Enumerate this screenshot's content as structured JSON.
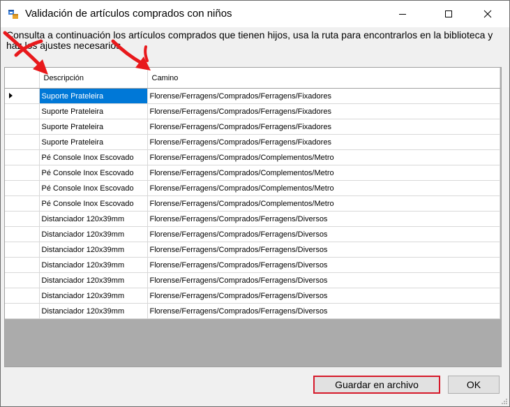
{
  "window": {
    "title": "Validación de artículos comprados con niños",
    "app_icon": "window-app-icon",
    "controls": {
      "minimize": "minimize-icon",
      "maximize": "maximize-icon",
      "close": "close-icon"
    }
  },
  "description": "Consulta a continuación los artículos comprados que tienen hijos, usa la ruta para encontrarlos en la biblioteca y haz los ajustes necesarios.",
  "grid": {
    "columns": [
      "Descripción",
      "Camino"
    ],
    "rows": [
      {
        "descripcion": "Suporte Prateleira",
        "camino": "Florense/Ferragens/Comprados/Ferragens/Fixadores"
      },
      {
        "descripcion": "Suporte Prateleira",
        "camino": "Florense/Ferragens/Comprados/Ferragens/Fixadores"
      },
      {
        "descripcion": "Suporte Prateleira",
        "camino": "Florense/Ferragens/Comprados/Ferragens/Fixadores"
      },
      {
        "descripcion": "Suporte Prateleira",
        "camino": "Florense/Ferragens/Comprados/Ferragens/Fixadores"
      },
      {
        "descripcion": "Pé Console Inox Escovado",
        "camino": "Florense/Ferragens/Comprados/Complementos/Metro"
      },
      {
        "descripcion": "Pé Console Inox Escovado",
        "camino": "Florense/Ferragens/Comprados/Complementos/Metro"
      },
      {
        "descripcion": "Pé Console Inox Escovado",
        "camino": "Florense/Ferragens/Comprados/Complementos/Metro"
      },
      {
        "descripcion": "Pé Console Inox Escovado",
        "camino": "Florense/Ferragens/Comprados/Complementos/Metro"
      },
      {
        "descripcion": "Distanciador 120x39mm",
        "camino": "Florense/Ferragens/Comprados/Ferragens/Diversos"
      },
      {
        "descripcion": "Distanciador 120x39mm",
        "camino": "Florense/Ferragens/Comprados/Ferragens/Diversos"
      },
      {
        "descripcion": "Distanciador 120x39mm",
        "camino": "Florense/Ferragens/Comprados/Ferragens/Diversos"
      },
      {
        "descripcion": "Distanciador 120x39mm",
        "camino": "Florense/Ferragens/Comprados/Ferragens/Diversos"
      },
      {
        "descripcion": "Distanciador 120x39mm",
        "camino": "Florense/Ferragens/Comprados/Ferragens/Diversos"
      },
      {
        "descripcion": "Distanciador 120x39mm",
        "camino": "Florense/Ferragens/Comprados/Ferragens/Diversos"
      },
      {
        "descripcion": "Distanciador 120x39mm",
        "camino": "Florense/Ferragens/Comprados/Ferragens/Diversos"
      }
    ],
    "selected_row": 0
  },
  "buttons": {
    "save": "Guardar en archivo",
    "ok": "OK"
  },
  "colors": {
    "selection": "#0078d7",
    "highlight": "#d6192a",
    "annotation_arrow": "#e8191c"
  }
}
